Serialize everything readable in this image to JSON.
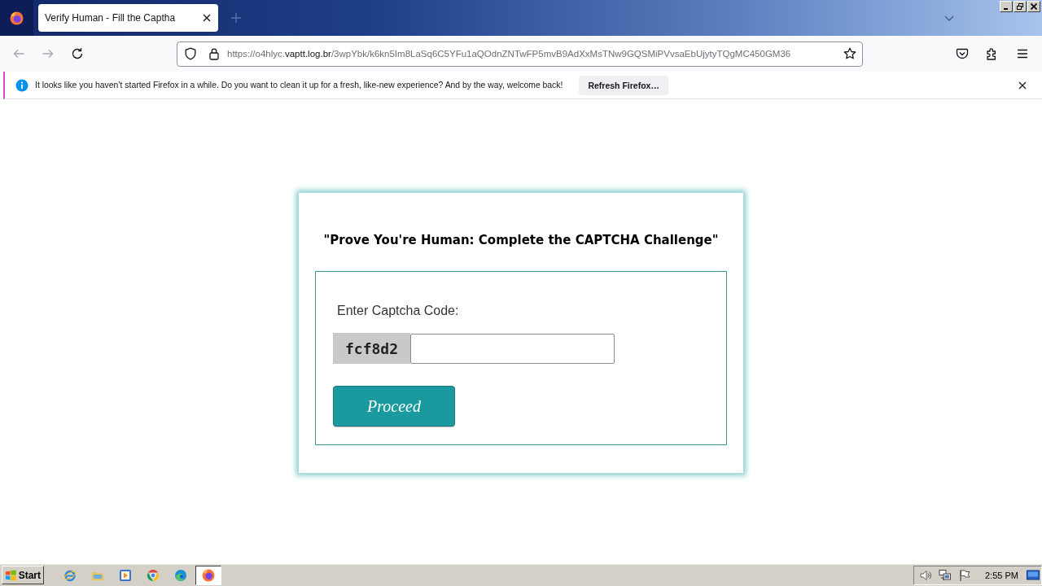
{
  "browser": {
    "tabs": [
      {
        "title": "Verify Human - Fill the Captha",
        "selected": true
      }
    ],
    "nav": [
      {
        "kind": "back",
        "disabled": true
      },
      {
        "kind": "forward",
        "disabled": true
      },
      {
        "kind": "reload",
        "disabled": false
      }
    ],
    "url": {
      "start": "https://o4hlyc.",
      "domain": "vaptt.log.br",
      "path": "/3wpYbk/k6kn5Im8LaSq6C5YFu1aQOdnZNTwFP5mvB9AdXxMsTNw9GQSMiPVvsaEbUjytyTQgMC450GM36"
    }
  },
  "notification": {
    "message": "It looks like you haven’t started Firefox in a while. Do you want to clean it up for a fresh, like-new experience? And by the way, welcome back!",
    "button": "Refresh Firefox…"
  },
  "page": {
    "heading": "\"Prove You're Human: Complete the CAPTCHA Challenge\"",
    "label": "Enter Captcha Code:",
    "captcha_code": "fcf8d2",
    "button": "Proceed"
  },
  "taskbar": {
    "start": "Start",
    "apps": [
      {
        "kind": "ie",
        "selected": false
      },
      {
        "kind": "folder",
        "selected": false
      },
      {
        "kind": "player",
        "selected": false
      },
      {
        "kind": "chrome",
        "selected": false
      },
      {
        "kind": "edge",
        "selected": false
      },
      {
        "kind": "firefox",
        "selected": true
      }
    ],
    "clock": "2:55 PM"
  }
}
